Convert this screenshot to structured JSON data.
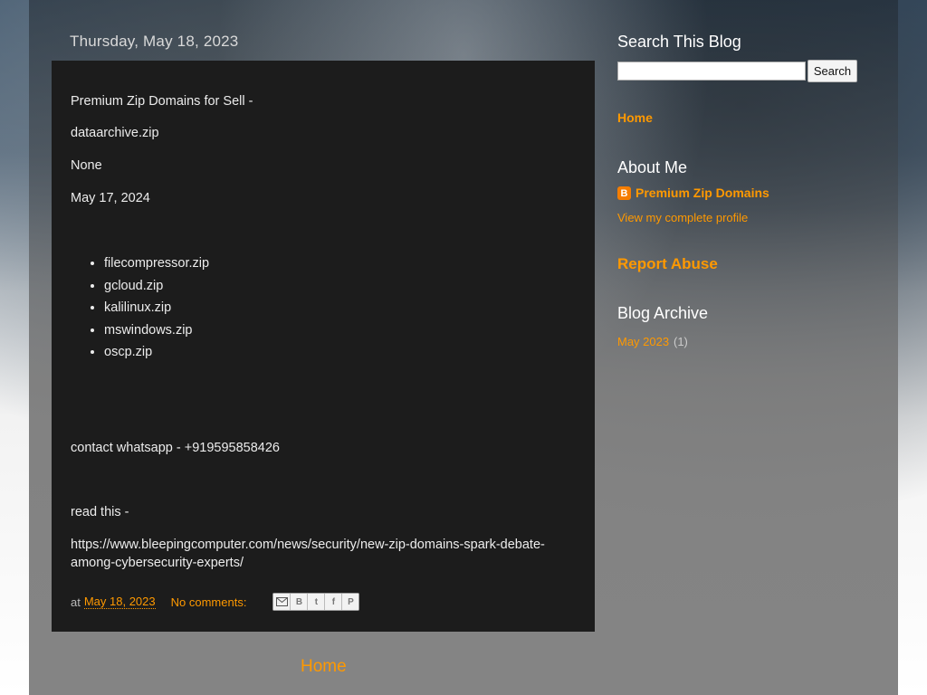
{
  "post": {
    "date_header": "Thursday, May 18, 2023",
    "paragraphs": {
      "title": " Premium Zip Domains for Sell -",
      "domain": "dataarchive.zip",
      "status": "None",
      "date": "May 17, 2024",
      "contact": "contact whatsapp - +919595858426",
      "read": "read this -",
      "url": "https://www.bleepingcomputer.com/news/security/new-zip-domains-spark-debate-among-cybersecurity-experts/"
    },
    "domains": [
      "filecompressor.zip",
      "gcloud.zip",
      "kalilinux.zip",
      "mswindows.zip",
      "oscp.zip"
    ],
    "footer": {
      "at": "at",
      "timestamp": "May 18, 2023",
      "comments": "No comments:"
    },
    "share_icons": [
      "email-icon",
      "blogthis-icon",
      "twitter-icon",
      "facebook-icon",
      "pinterest-icon"
    ]
  },
  "nav": {
    "home": "Home"
  },
  "sidebar": {
    "search_title": "Search This Blog",
    "search_button": "Search",
    "home_link": "Home",
    "about_title": "About Me",
    "profile_name": "Premium Zip Domains",
    "profile_link": "View my complete profile",
    "report_abuse": "Report Abuse",
    "archive_title": "Blog Archive",
    "archive_month": "May 2023",
    "archive_count": "(1)"
  },
  "colors": {
    "link": "#ff9900",
    "post_bg": "#1c1c1c",
    "text": "#ececec"
  }
}
